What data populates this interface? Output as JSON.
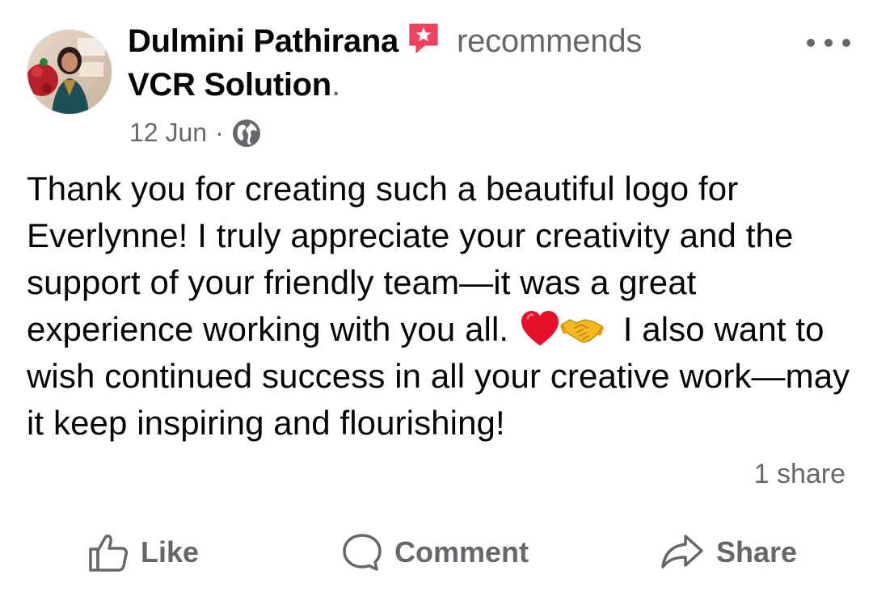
{
  "post": {
    "author": "Dulmini Pathirana",
    "verb": "recommends",
    "page_name": "VCR Solution",
    "period": ".",
    "date": "12 Jun",
    "separator": "·",
    "audience_icon": "globe-icon",
    "recommendation_icon": "recommendation-badge-icon",
    "body_parts": [
      "Thank you for creating such a beautiful logo for Everlynne! I truly appreciate your creativity and the support of your friendly team—it was a great experience working with you all. ",
      " I also want to wish continued success in all your creative work—may it keep inspiring and flourishing!"
    ],
    "emojis": [
      "red-heart",
      "handshake"
    ],
    "share_count": "1 share"
  },
  "actions": {
    "like": "Like",
    "comment": "Comment",
    "share": "Share"
  },
  "colors": {
    "primary_text": "#050505",
    "secondary_text": "#65676b",
    "badge": "#f3425f"
  }
}
